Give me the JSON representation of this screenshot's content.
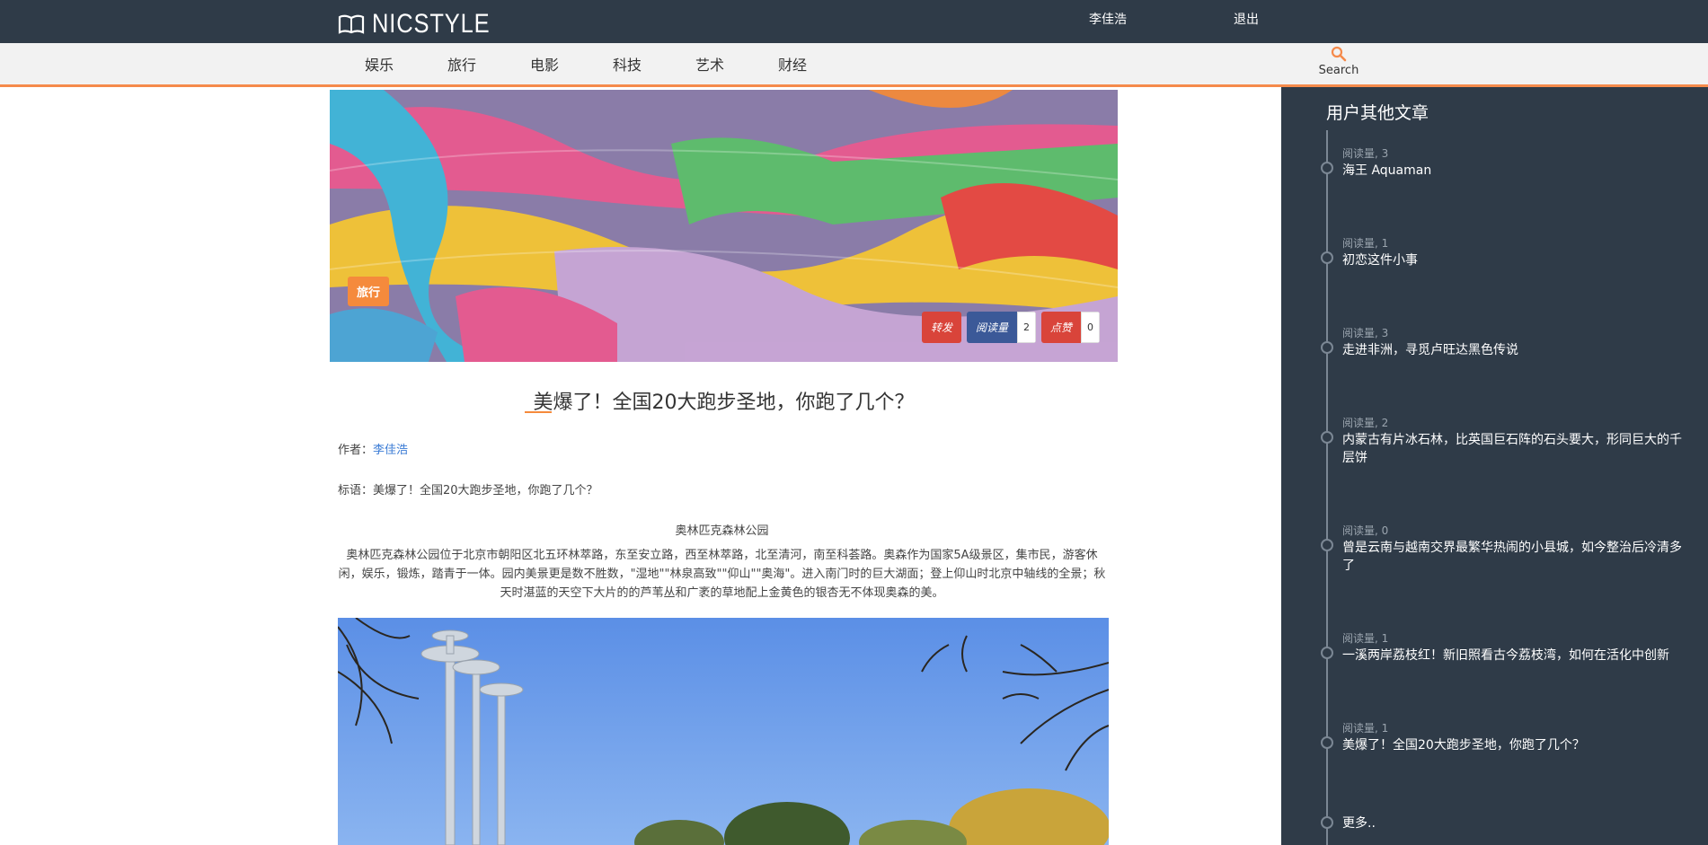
{
  "header": {
    "brand": "NICSTYLE",
    "user": "李佳浩",
    "logout": "退出"
  },
  "nav": {
    "items": [
      "娱乐",
      "旅行",
      "电影",
      "科技",
      "艺术",
      "财经"
    ],
    "search_label": "Search"
  },
  "hero": {
    "category": "旅行",
    "share_label": "转发",
    "read_label": "阅读量",
    "read_count": "2",
    "like_label": "点赞",
    "like_count": "0"
  },
  "article": {
    "title": "美爆了！全国20大跑步圣地，你跑了几个？",
    "author_prefix": "作者：",
    "author_name": "李佳浩",
    "subtitle": "标语：美爆了！全国20大跑步圣地，你跑了几个？",
    "section_heading": "奥林匹克森林公园",
    "paragraph": "奥林匹克森林公园位于北京市朝阳区北五环林萃路，东至安立路，西至林萃路，北至清河，南至科荟路。奥森作为国家5A级景区，集市民，游客休闲，娱乐，锻炼，踏青于一体。园内美景更是数不胜数，\"湿地\"\"林泉高致\"\"仰山\"\"奥海\"。进入南门时的巨大湖面；登上仰山时北京中轴线的全景；秋天时湛蓝的天空下大片的的芦苇丛和广袤的草地配上金黄色的银杏无不体现奥森的美。"
  },
  "sidebar": {
    "title": "用户其他文章",
    "items": [
      {
        "meta": "阅读量, 3",
        "title": "海王 Aquaman"
      },
      {
        "meta": "阅读量, 1",
        "title": "初恋这件小事"
      },
      {
        "meta": "阅读量, 3",
        "title": "走进非洲，寻觅卢旺达黑色传说"
      },
      {
        "meta": "阅读量, 2",
        "title": "内蒙古有片冰石林，比英国巨石阵的石头要大，形同巨大的千层饼"
      },
      {
        "meta": "阅读量, 0",
        "title": "曾是云南与越南交界最繁华热闹的小县城，如今整治后冷清多了"
      },
      {
        "meta": "阅读量, 1",
        "title": "一溪两岸荔枝红！新旧照看古今荔枝湾，如何在活化中创新"
      },
      {
        "meta": "阅读量, 1",
        "title": "美爆了！全国20大跑步圣地，你跑了几个？"
      }
    ],
    "more": "更多.."
  },
  "colors": {
    "topbar": "#2f3b48",
    "accent": "#f58a4b",
    "sidebar": "#2f3b48"
  }
}
